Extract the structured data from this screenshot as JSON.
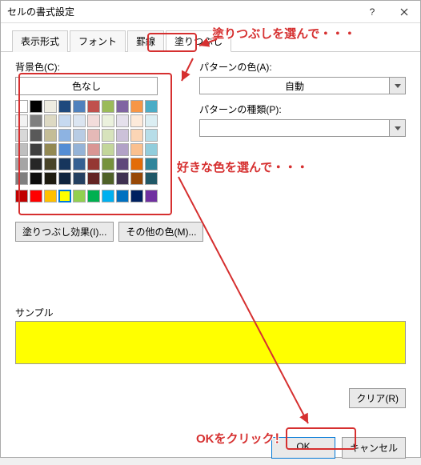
{
  "title": "セルの書式設定",
  "tabs": {
    "format": "表示形式",
    "font": "フォント",
    "border": "罫線",
    "fill": "塗りつぶし"
  },
  "labels": {
    "bgcolor": "背景色(C):",
    "nocolor": "色なし",
    "pattern_color": "パターンの色(A):",
    "pattern_color_value": "自動",
    "pattern_type": "パターンの種類(P):",
    "fill_effects": "塗りつぶし効果(I)...",
    "other_colors": "その他の色(M)...",
    "sample": "サンプル",
    "clear": "クリア(R)",
    "ok": "OK",
    "cancel": "キャンセル"
  },
  "annotations": {
    "a1": "塗りつぶしを選んで・・・",
    "a2": "好きな色を選んで・・・",
    "a3": "OKをクリック！"
  },
  "swatches_row1": [
    "#ffffff",
    "#000000",
    "#eeece1",
    "#1f497d",
    "#4f81bd",
    "#c0504d",
    "#9bbb59",
    "#8064a2",
    "#f79646",
    "#4bacc6"
  ],
  "swatches_row2": [
    "#f2f2f2",
    "#7f7f7f",
    "#ddd9c3",
    "#c6d9f0",
    "#dbe5f1",
    "#f2dcdb",
    "#ebf1dd",
    "#e5e0ec",
    "#fdeada",
    "#dbeef3"
  ],
  "swatches_row3": [
    "#d8d8d8",
    "#595959",
    "#c4bd97",
    "#8db3e2",
    "#b8cce4",
    "#e5b9b7",
    "#d7e3bc",
    "#ccc1d9",
    "#fbd5b5",
    "#b7dde8"
  ],
  "swatches_row4": [
    "#bfbfbf",
    "#3f3f3f",
    "#938953",
    "#548dd4",
    "#95b3d7",
    "#d99694",
    "#c3d69b",
    "#b2a2c7",
    "#fac08f",
    "#92cddc"
  ],
  "swatches_row5": [
    "#a5a5a5",
    "#262626",
    "#494429",
    "#17365d",
    "#366092",
    "#953734",
    "#76923c",
    "#5f497a",
    "#e36c09",
    "#31859b"
  ],
  "swatches_row6": [
    "#7f7f7f",
    "#0c0c0c",
    "#1d1b10",
    "#0f243e",
    "#244061",
    "#632423",
    "#4f6128",
    "#3f3151",
    "#974806",
    "#205867"
  ],
  "swatches_row7": [
    "#c00000",
    "#ff0000",
    "#ffc000",
    "#ffff00",
    "#92d050",
    "#00b050",
    "#00b0f0",
    "#0070c0",
    "#002060",
    "#7030a0"
  ]
}
